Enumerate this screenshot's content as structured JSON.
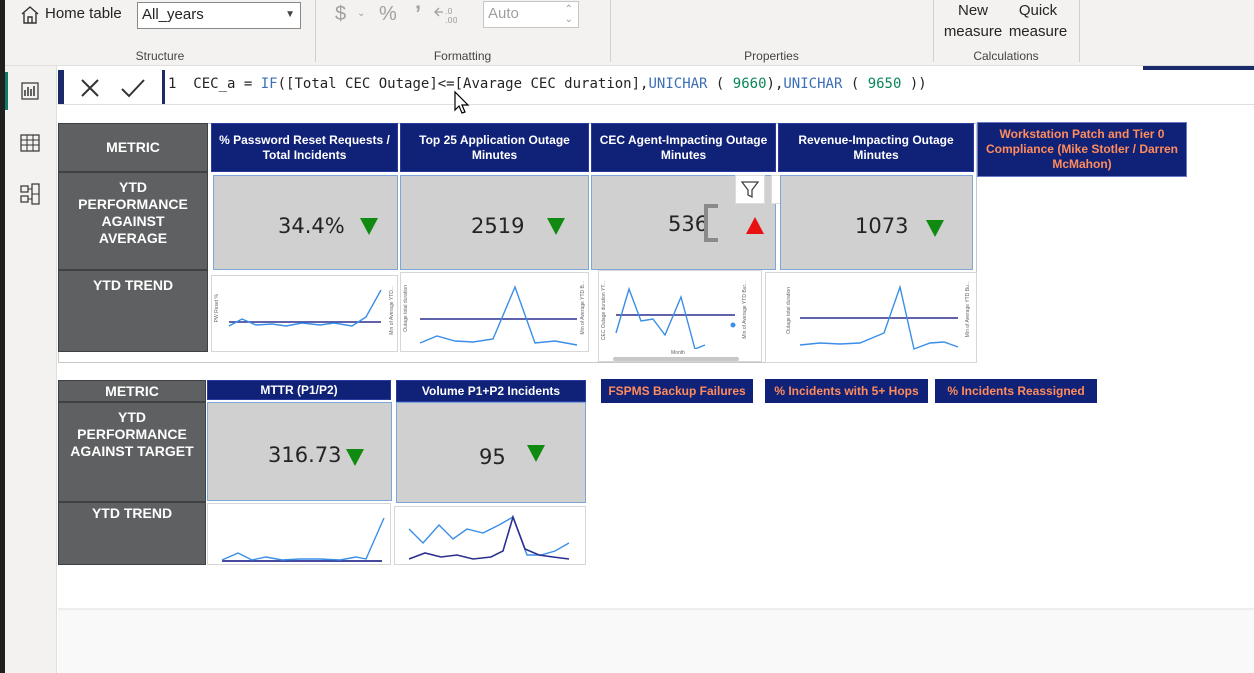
{
  "ribbon": {
    "home_table_label": "Home table",
    "home_table_value": "All_years",
    "format_auto_placeholder": "Auto",
    "currency_symbol": "$",
    "percent_symbol": "%",
    "comma_symbol": "’",
    "new_measure_line1": "New",
    "new_measure_line2": "measure",
    "quick_measure_line1": "Quick",
    "quick_measure_line2": "measure",
    "groups": [
      "Structure",
      "Formatting",
      "Properties",
      "Calculations"
    ]
  },
  "formula_bar": {
    "line_number": "1",
    "measure_name": "CEC_a",
    "expression_prefix": " = ",
    "if_kw": "IF",
    "condition": "([Total CEC Outage]<=[Avarage CEC duration],",
    "unichar_kw": "UNICHAR",
    "arg1": "9660",
    "arg2": "9650",
    "open_paren": " ( ",
    "close_paren1": "),",
    "close_paren2": " ))"
  },
  "row1": {
    "metric_label": "METRIC",
    "ytd_perf_label": "YTD PERFORMANCE AGAINST AVERAGE",
    "ytd_trend_label": "YTD  TREND",
    "columns": [
      {
        "header": "% Password Reset Requests / Total Incidents",
        "value": "34.4%",
        "indicator": "down",
        "trend_ylabel": "PW Reset %",
        "trend_ylabel2": "Min of Average YTD..."
      },
      {
        "header": "Top 25 Application Outage Minutes",
        "value": "2519",
        "indicator": "down",
        "trend_ylabel": "Outage total duration",
        "trend_ylabel2": "Min of Average YTD B..."
      },
      {
        "header": "CEC Agent-Impacting Outage Minutes",
        "value": "536",
        "indicator": "up",
        "trend_ylabel": "CEC Outage duration YT...",
        "trend_ylabel2": "Min of Average YTD Bur...",
        "trend_xlabel": "Month"
      },
      {
        "header": "Revenue-Impacting Outage Minutes",
        "value": "1073",
        "indicator": "down",
        "trend_ylabel": "Outage total duration",
        "trend_ylabel2": "Min of Average YTD Bu..."
      }
    ],
    "extra_header": "Workstation Patch and Tier 0 Compliance (Mike Stotler / Darren McMahon)"
  },
  "row2": {
    "metric_label": "METRIC",
    "ytd_perf_label": "YTD PERFORMANCE AGAINST TARGET",
    "ytd_trend_label": "YTD TREND",
    "columns": [
      {
        "header": "MTTR (P1/P2)",
        "value": "316.73",
        "indicator": "down"
      },
      {
        "header": "Volume P1+P2 Incidents",
        "value": "95",
        "indicator": "down"
      }
    ],
    "extra_headers": [
      "FSPMS Backup Failures",
      "% Incidents with 5+ Hops",
      "% Incidents Reassigned"
    ]
  },
  "colors": {
    "navy": "#102178",
    "grey_label": "#5f6062",
    "kpi_bg": "#d0d0d0",
    "down_green": "#108a10",
    "up_red": "#e81010",
    "trend_line": "#3a8ee6",
    "avg_line": "#2b2f8f",
    "orange_text": "#ff8c5a"
  },
  "icons": [
    "home-icon",
    "report-view-icon",
    "table-view-icon",
    "model-view-icon",
    "close-icon",
    "check-icon",
    "filter-icon",
    "more-options-icon"
  ]
}
